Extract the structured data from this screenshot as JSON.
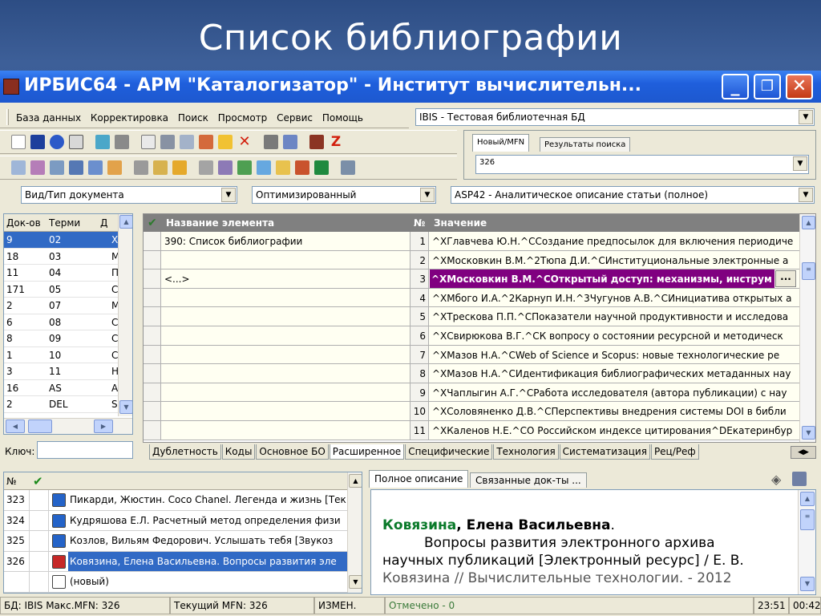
{
  "slide_title": "Список библиографии",
  "window": {
    "title": "ИРБИС64 - АРМ \"Каталогизатор\" - Институт вычислительн...",
    "min_glyph": "_",
    "max_glyph": "❐",
    "close_glyph": "✕"
  },
  "menu": [
    "База данных",
    "Корректировка",
    "Поиск",
    "Просмотр",
    "Сервис",
    "Помощь"
  ],
  "db_select": "IBIS - Тестовая библиотечная БД",
  "top_tabs": [
    "Новый/MFN",
    "Результаты поиска"
  ],
  "mfn_value": "326",
  "filters": {
    "doc_type": "Вид/Тип документа",
    "mode": "Оптимизированный",
    "worksheet": "ASP42 - Аналитическое описание статьи (полное)"
  },
  "terms_table": {
    "headers": [
      "Док-ов",
      "Терми",
      "Д"
    ],
    "rows": [
      [
        "9",
        "02",
        "Х"
      ],
      [
        "18",
        "03",
        "М"
      ],
      [
        "11",
        "04",
        "П"
      ],
      [
        "171",
        "05",
        "С"
      ],
      [
        "2",
        "07",
        "М"
      ],
      [
        "6",
        "08",
        "С"
      ],
      [
        "8",
        "09",
        "С"
      ],
      [
        "1",
        "10",
        "С"
      ],
      [
        "3",
        "11",
        "Н"
      ],
      [
        "16",
        "AS",
        "A"
      ],
      [
        "2",
        "DEL",
        "S"
      ]
    ],
    "key_label": "Ключ:"
  },
  "fields_table": {
    "headers": {
      "check": "✔",
      "name": "Название элемента",
      "num": "№",
      "value": "Значение"
    },
    "rows": [
      {
        "name": "390: Список библиографии",
        "num": "1",
        "value": "^XГлавчева Ю.Н.^CСоздание предпосылок для включения периодиче"
      },
      {
        "name": "",
        "num": "2",
        "value": "^XМосковкин В.М.^2Тюпа Д.И.^CИнституциональные электронные а"
      },
      {
        "name": "<...>",
        "num": "3",
        "value": "^XМосковкин В.М.^CОткрытый доступ: механизмы, инструм",
        "selected": true
      },
      {
        "name": "",
        "num": "4",
        "value": "^XМбого И.А.^2Карнуп И.Н.^3Чугунов А.В.^CИнициатива открытых а"
      },
      {
        "name": "",
        "num": "5",
        "value": "^XТрескова П.П.^CПоказатели научной продуктивности и исследова"
      },
      {
        "name": "",
        "num": "6",
        "value": "^XСвирюкова В.Г.^CК вопросу о состоянии ресурсной и методическ"
      },
      {
        "name": "",
        "num": "7",
        "value": "^XМазов Н.А.^CWeb of Science и Scopus: новые технологические ре"
      },
      {
        "name": "",
        "num": "8",
        "value": "^XМазов Н.А.^CИдентификация библиографических метаданных нау"
      },
      {
        "name": "",
        "num": "9",
        "value": "^XЧаплыгин А.Г.^CРабота исследователя (автора публикации) с нау"
      },
      {
        "name": "",
        "num": "10",
        "value": "^XСоловяненко Д.В.^CПерспективы внедрения системы DOI в библи"
      },
      {
        "name": "",
        "num": "11",
        "value": "^XКаленов Н.Е.^CО Российском индексе цитирования^DЕкатеринбур"
      }
    ],
    "ellipsis_button": "..."
  },
  "bottom_tabs": [
    "Дублетность",
    "Коды",
    "Основное БО",
    "Расширенное",
    "Специфические",
    "Технология",
    "Систематизация",
    "Рец/Реф"
  ],
  "records_table": {
    "headers": [
      "№",
      "✔"
    ],
    "rows": [
      {
        "num": "323",
        "text": "Пикарди, Жюстин. Coco Chanel. Легенда и жизнь [Тек"
      },
      {
        "num": "324",
        "text": "Кудряшова Е.Л. Расчетный метод определения физи"
      },
      {
        "num": "325",
        "text": "Козлов, Вильям Федорович. Услышать тебя [Звукоз"
      },
      {
        "num": "326",
        "text": "Ковязина, Елена Васильевна. Вопросы развития эле",
        "selected": true
      },
      {
        "num": "",
        "text": "(новый)"
      }
    ]
  },
  "desc_tabs": [
    "Полное описание",
    "Связанные док-ты ..."
  ],
  "description": {
    "author_surname": "Ковязина",
    "author_rest": ", Елена Васильевна",
    "line1": "Вопросы развития электронного архива",
    "line2": "научных публикаций [Электронный ресурс] / Е. В.",
    "line3": "Ковязина // Вычислительные технологии. - 2012"
  },
  "status": {
    "db": "БД: IBIS Макс.MFN: 326",
    "current": "Текущий MFN: 326",
    "changed": "ИЗМЕН.",
    "marked": "Отмечено - 0",
    "time": "23:51",
    "time2": "00:42"
  },
  "colors": {
    "accent_blue": "#316ac5",
    "selected_row": "#800080",
    "author_green": "#0a7a2a"
  }
}
